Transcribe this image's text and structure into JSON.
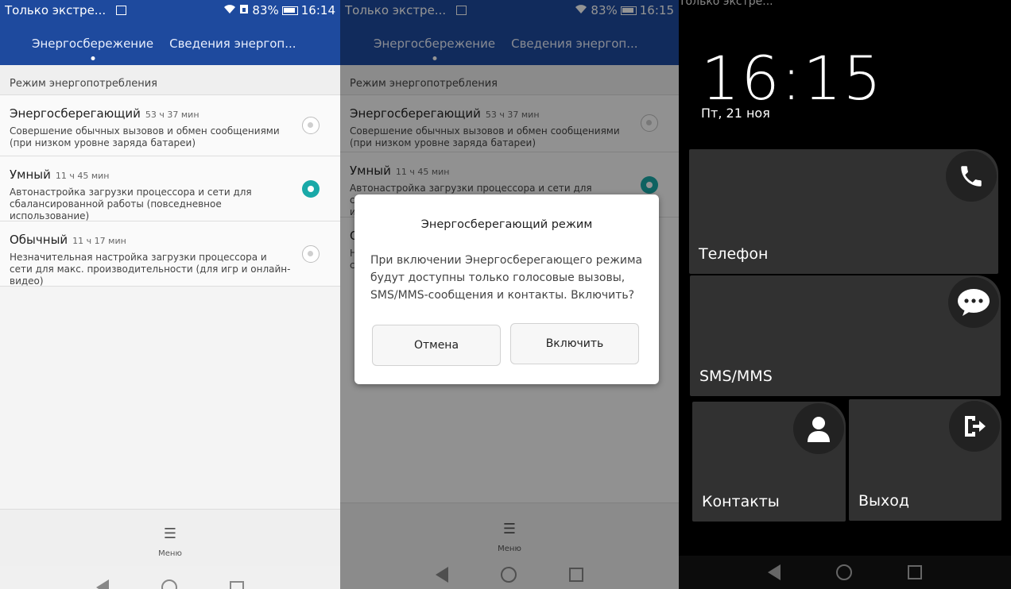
{
  "status": {
    "left_text": "Только экстре...",
    "right_text": "83%",
    "time_left": "16:14",
    "time_mid": "16:15"
  },
  "tabs": {
    "power_saving": "Энергосбережение",
    "power_info": "Сведения энергоп..."
  },
  "section_title": "Режим энергопотребления",
  "modes": [
    {
      "name": "Энергосберегающий",
      "duration": "53 ч 37 мин",
      "desc": "Совершение обычных вызовов и обмен сообщениями (при низком уровне заряда батареи)",
      "selected": false
    },
    {
      "name": "Умный",
      "duration": "11 ч 45 мин",
      "desc": "Автонастройка загрузки процессора и сети для сбалансированной работы (повседневное использование)",
      "selected": true
    },
    {
      "name": "Обычный",
      "duration": "11 ч 17 мин",
      "desc": "Незначительная настройка загрузки процессора и сети для макс. производительности (для игр и онлайн-видео)",
      "selected": false
    }
  ],
  "menu_label": "Меню",
  "dialog": {
    "title": "Энергосберегающий режим",
    "body": "При включении Энергосберегающего режима будут доступны только голосовые вызовы, SMS/MMS-сообщения и контакты. Включить?",
    "cancel": "Отмена",
    "enable": "Включить"
  },
  "launcher": {
    "top_text": "Только экстре...",
    "clock": "16:15",
    "date": "Пт, 21 ноя",
    "tiles": {
      "phone": "Телефон",
      "sms": "SMS/MMS",
      "contacts": "Контакты",
      "exit": "Выход"
    }
  },
  "colors": {
    "header_blue": "#1e4a9e",
    "accent_teal": "#19a9a8",
    "tile_gray": "#313131"
  },
  "icons": [
    "wifi-icon",
    "sim-icon",
    "battery-icon",
    "menu-icon",
    "phone-icon",
    "chat-icon",
    "contact-icon",
    "exit-icon",
    "back-icon",
    "home-icon",
    "recent-icon"
  ]
}
